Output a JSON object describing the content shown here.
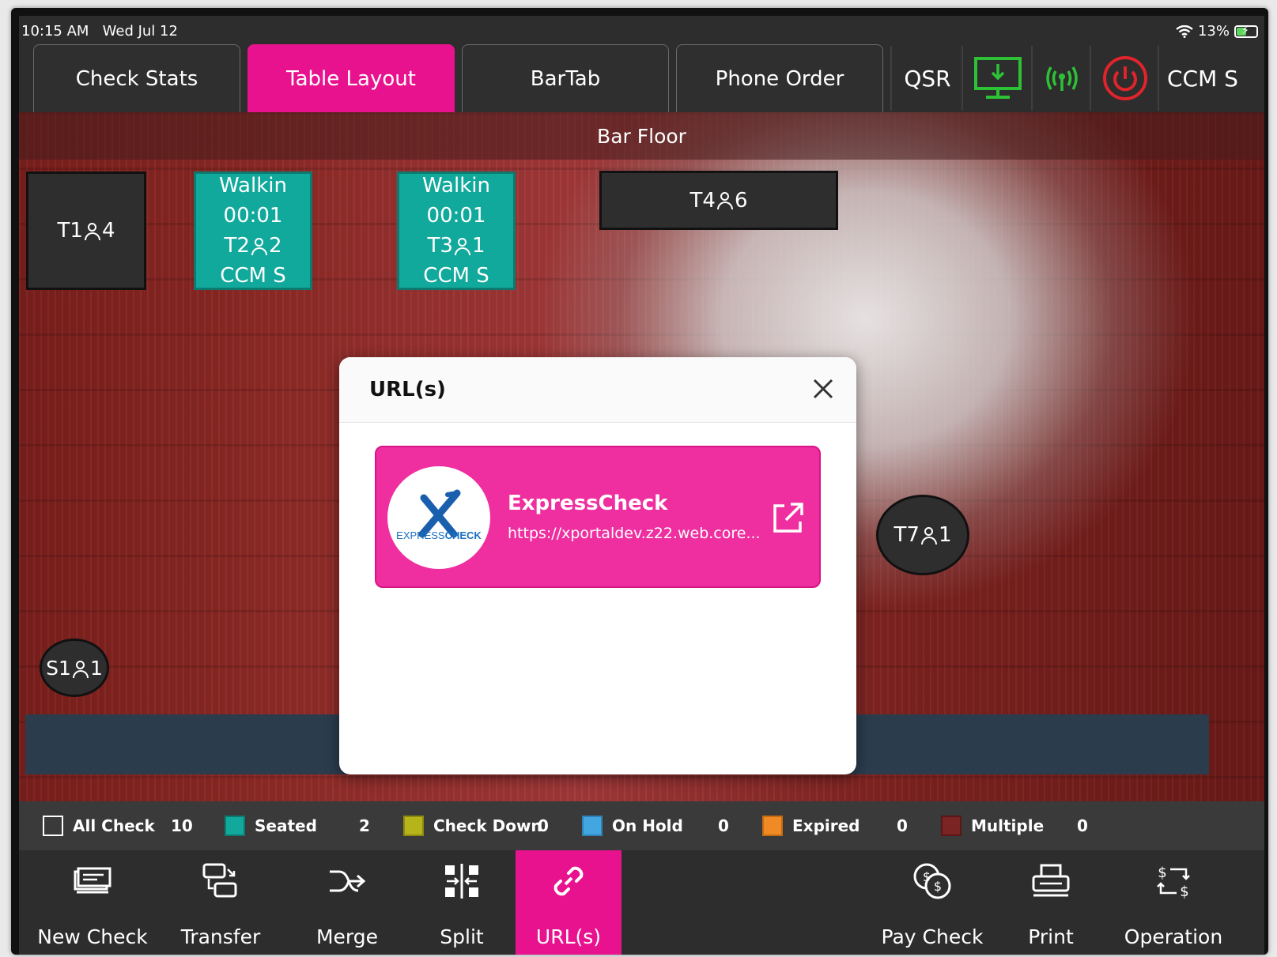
{
  "status_bar": {
    "time": "10:15 AM",
    "date": "Wed Jul 12",
    "battery": "13%"
  },
  "top_tabs": [
    {
      "label": "Check Stats",
      "active": false
    },
    {
      "label": "Table Layout",
      "active": true
    },
    {
      "label": "BarTab",
      "active": false
    },
    {
      "label": "Phone Order",
      "active": false
    }
  ],
  "top_toolbar": {
    "qsr": "QSR",
    "user": "CCM S",
    "download_icon": "monitor-download-icon",
    "signal_icon": "broadcast-signal-icon",
    "power_icon": "power-icon"
  },
  "floor": {
    "title": "Bar Floor",
    "tables": [
      {
        "id": "t1",
        "name": "T1",
        "guests": "4",
        "state": "empty"
      },
      {
        "id": "t2",
        "status": "Walkin",
        "time": "00:01",
        "name": "T2",
        "guests": "2",
        "server": "CCM S",
        "state": "seated"
      },
      {
        "id": "t3",
        "status": "Walkin",
        "time": "00:01",
        "name": "T3",
        "guests": "1",
        "server": "CCM S",
        "state": "seated"
      },
      {
        "id": "t4",
        "name": "T4",
        "guests": "6",
        "state": "empty"
      },
      {
        "id": "t7",
        "name": "T7",
        "guests": "1",
        "state": "empty"
      },
      {
        "id": "s1",
        "name": "S1",
        "guests": "1",
        "state": "empty"
      }
    ]
  },
  "legend": [
    {
      "label": "All Check",
      "count": "10",
      "color": "transparent"
    },
    {
      "label": "Seated",
      "count": "2",
      "color": "#11a99c"
    },
    {
      "label": "Check Down",
      "count": "0",
      "color": "#b5b41a"
    },
    {
      "label": "On Hold",
      "count": "0",
      "color": "#43a6e0"
    },
    {
      "label": "Expired",
      "count": "0",
      "color": "#ef8a24"
    },
    {
      "label": "Multiple",
      "count": "0",
      "color": "#7a2424"
    }
  ],
  "bottom_toolbar": [
    {
      "label": "New Check",
      "icon": "new-check-icon"
    },
    {
      "label": "Transfer",
      "icon": "transfer-icon"
    },
    {
      "label": "Merge",
      "icon": "merge-icon"
    },
    {
      "label": "Split",
      "icon": "split-icon"
    },
    {
      "label": "URL(s)",
      "icon": "link-icon",
      "active": true
    },
    {
      "label": "Pay Check",
      "icon": "pay-check-icon"
    },
    {
      "label": "Print",
      "icon": "printer-icon"
    },
    {
      "label": "Operation",
      "icon": "operation-icon"
    }
  ],
  "modal": {
    "title": "URL(s)",
    "items": [
      {
        "name": "ExpressCheck",
        "url": "https://xportaldev.z22.web.core....",
        "logo_text_a": "EXPRESS",
        "logo_text_b": "CHECK"
      }
    ]
  },
  "colors": {
    "accent": "#e8128f",
    "seated": "#11a99c",
    "card": "#ef2f9f",
    "power": "#e0242b",
    "online": "#2dc236"
  }
}
